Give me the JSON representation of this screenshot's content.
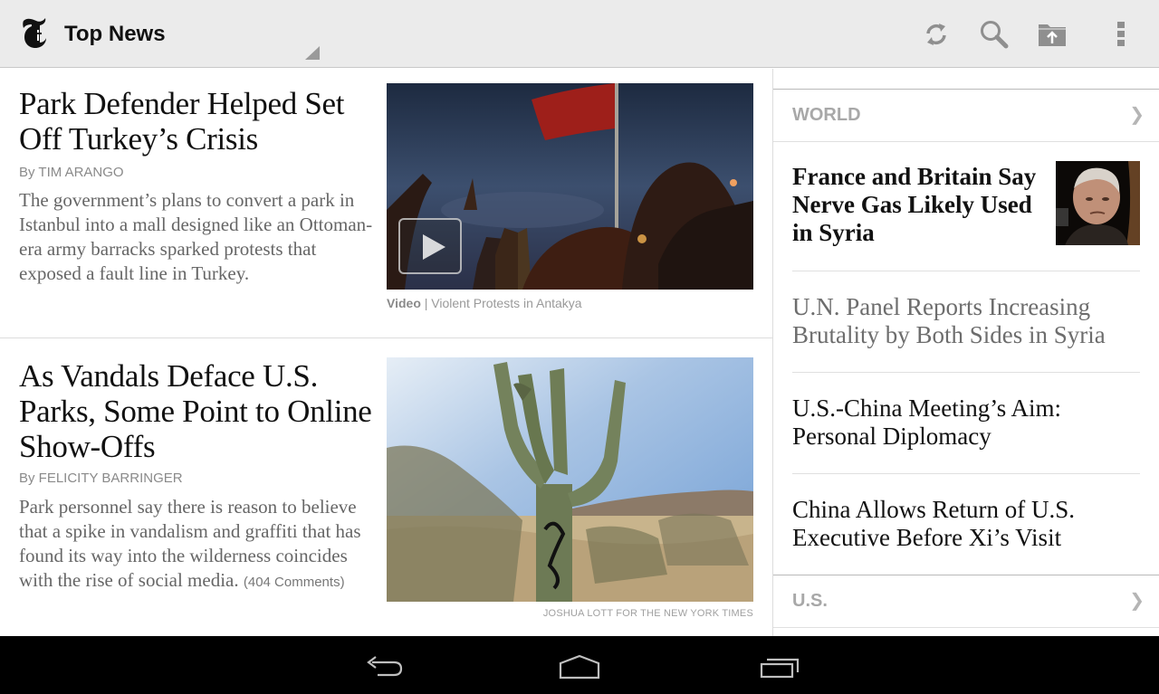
{
  "actionbar": {
    "title": "Top News",
    "icons": [
      "refresh-icon",
      "search-icon",
      "saved-folder-icon",
      "overflow-menu-icon"
    ]
  },
  "articles": [
    {
      "headline": "Park Defender Helped Set Off Turkey’s Crisis",
      "byline": "By TIM ARANGO",
      "summary": "The government’s plans to convert a park in Istanbul into a mall designed like an Ottoman-era army barracks sparked protests that exposed a fault line in Turkey.",
      "caption_kind": "Video",
      "caption_sep": " | ",
      "caption_text": "Violent Protests in Antakya"
    },
    {
      "headline": "As Vandals Deface U.S. Parks, Some Point to Online Show-Offs",
      "byline": "By FELICITY BARRINGER",
      "summary": "Park personnel say there is reason to believe that a spike in vandalism and graffiti that has found its way into the wilderness coincides with the rise of social media.",
      "comments": "(404 Comments)",
      "credit": "JOSHUA LOTT FOR THE NEW YORK TIMES"
    }
  ],
  "sidebar": {
    "sections": [
      {
        "label": "WORLD",
        "chevron": "❯",
        "stories": [
          "France and Britain Say Nerve Gas Likely Used in Syria",
          "U.N. Panel Reports Increasing Brutality by Both Sides in Syria",
          "U.S.-China Meeting’s Aim: Personal Diplomacy",
          "China Allows Return of U.S. Executive Before Xi’s Visit"
        ]
      },
      {
        "label": "U.S.",
        "chevron": "❯"
      }
    ]
  },
  "navbar": {
    "buttons": [
      "back",
      "home",
      "recent-apps"
    ]
  }
}
